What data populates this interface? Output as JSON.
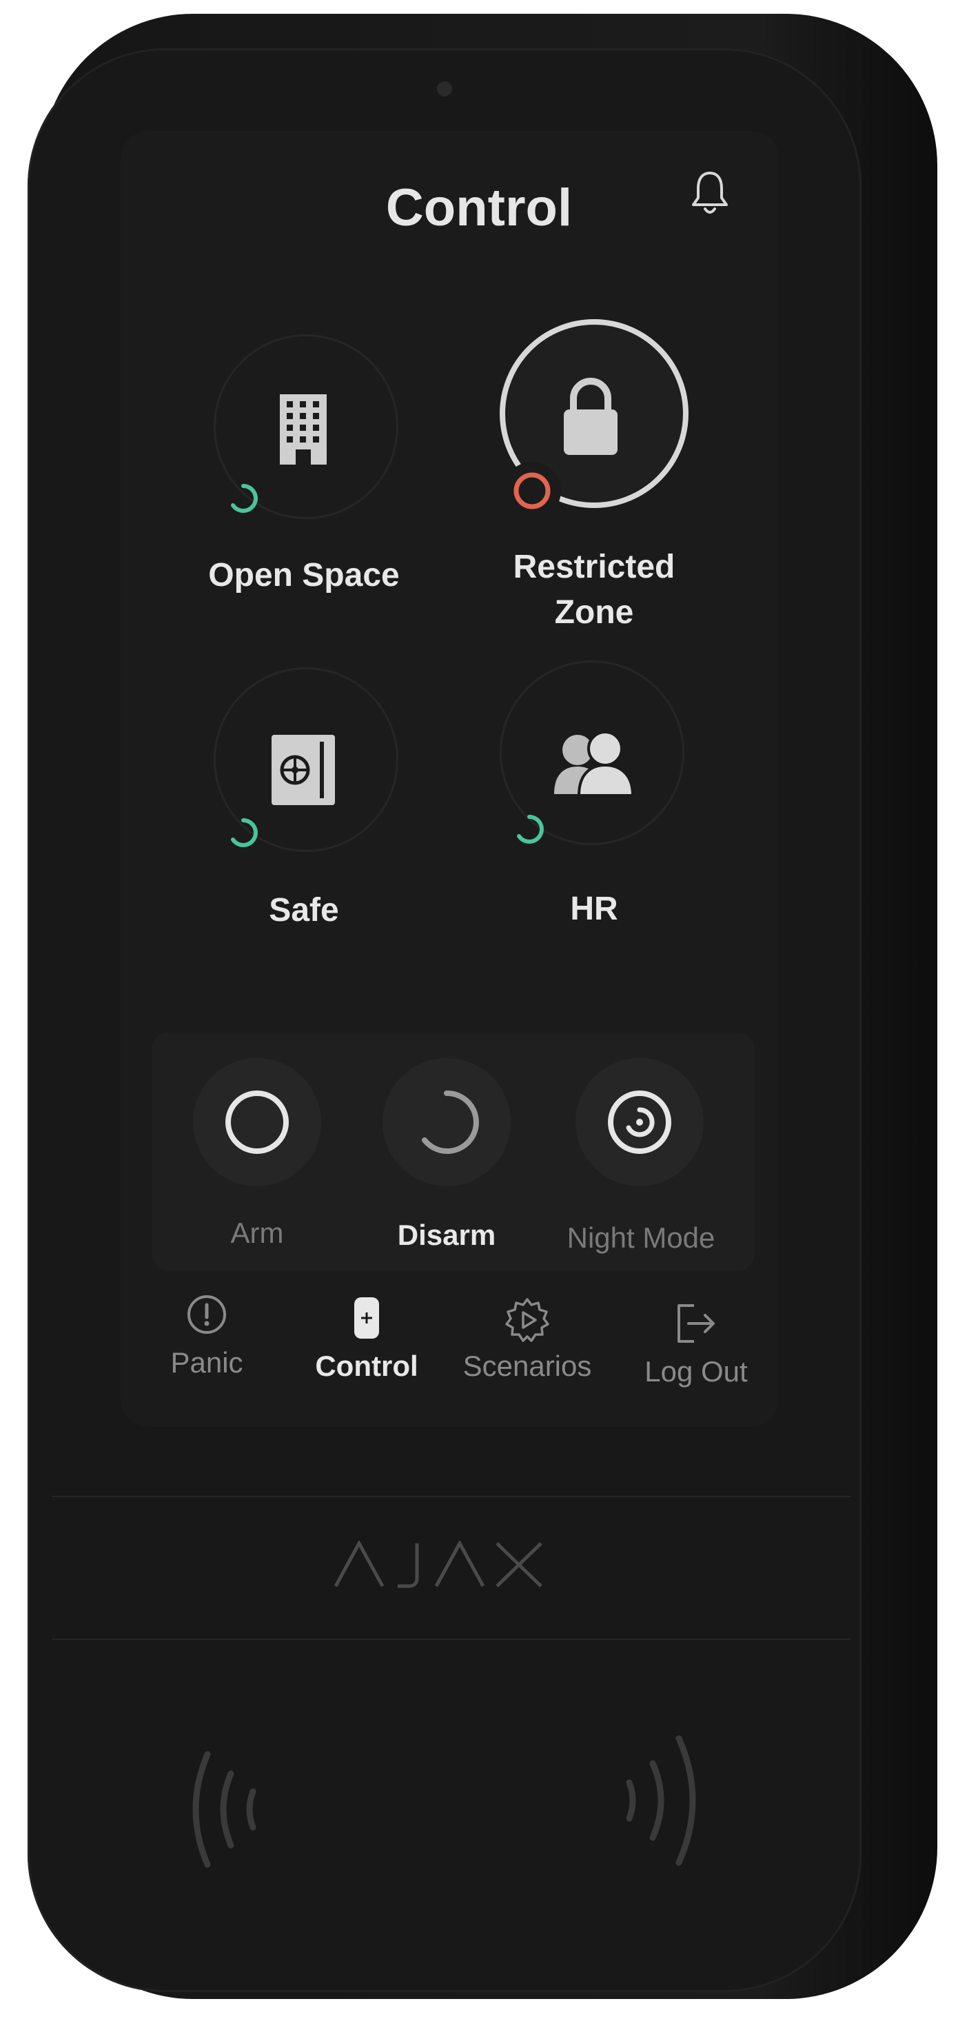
{
  "header": {
    "title": "Control"
  },
  "zones": [
    {
      "label": "Open Space",
      "icon": "building-icon",
      "status": "disarmed",
      "selected": false
    },
    {
      "label": "Restricted Zone",
      "icon": "lock-icon",
      "status": "armed",
      "selected": true
    },
    {
      "label": "Safe",
      "icon": "safe-icon",
      "status": "disarmed",
      "selected": false
    },
    {
      "label": "HR",
      "icon": "users-icon",
      "status": "disarmed",
      "selected": false
    }
  ],
  "controls": {
    "arm_label": "Arm",
    "disarm_label": "Disarm",
    "night_label": "Night Mode"
  },
  "nav": {
    "panic": "Panic",
    "control": "Control",
    "scenarios": "Scenarios",
    "logout": "Log Out"
  },
  "brand": {
    "logo": "AJAX"
  },
  "colors": {
    "disarmed": "#49c59a",
    "armed": "#e0654f",
    "text": "#e8e8e8",
    "muted": "#7a7a7a"
  }
}
